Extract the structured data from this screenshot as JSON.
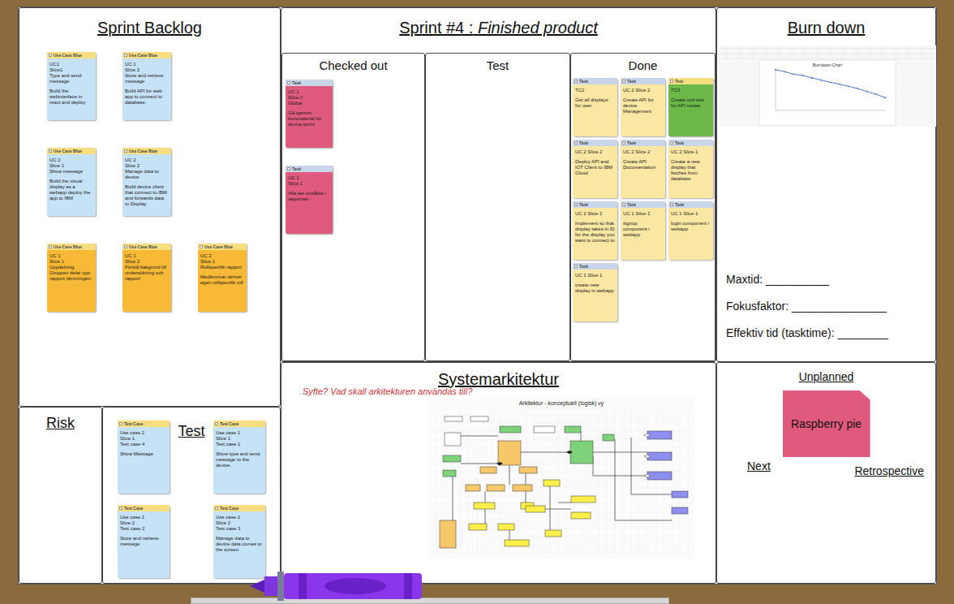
{
  "backlog": {
    "title": "Sprint Backlog",
    "rows": [
      [
        {
          "header": "Use Case Blue",
          "title": [
            "UC1",
            "Slice1",
            "Type and send message"
          ],
          "body": "Build the webinterface in react and deploy",
          "color": "#c5e2f6",
          "header_color": "#f6de80"
        },
        {
          "header": "Use Case Blue",
          "title": [
            "UC 1",
            "Slice 2",
            "Store and retrieve message"
          ],
          "body": "Build API for web app to connect to database.",
          "color": "#c5e2f6",
          "header_color": "#f6de80"
        }
      ],
      [
        {
          "header": "Use Case Blue",
          "title": [
            "UC 2",
            "Slice 1",
            "Show message"
          ],
          "body": "Build the visual display as a webapp deploy the app to IBM",
          "color": "#c5e2f6",
          "header_color": "#f6de80"
        },
        {
          "header": "Use Case Blue",
          "title": [
            "UC 2",
            "Slice 2",
            "Manage data to device"
          ],
          "body": "Build device client that connect to IBM and forwards data to Display",
          "color": "#c5e2f6",
          "header_color": "#f6de80"
        }
      ],
      [
        {
          "header": "Use Case Blue",
          "title": [
            "UC 1",
            "Slice 1",
            "Uppdelning Gruppen delar upp rapport skrivningen"
          ],
          "body": "",
          "color": "#f8b936",
          "header_color": "#f6de80"
        },
        {
          "header": "Use Case Blue",
          "title": [
            "UC 1",
            "Slice 2",
            "Förstå bakgrund till undersökning och rapport"
          ],
          "body": "",
          "color": "#f8b936",
          "header_color": "#f6de80"
        },
        {
          "header": "Use Case Blue",
          "title": [
            "UC 2",
            "Slice 1",
            "Rollspecifik rapport"
          ],
          "body": "Medlemmar skriver egen rollspecifik roll",
          "color": "#f8b936",
          "header_color": "#f6de80"
        }
      ]
    ]
  },
  "sprint": {
    "label": "Sprint #4 :",
    "name": "Finished product",
    "columns": [
      {
        "title": "Checked out",
        "cards": [
          {
            "header": "Task",
            "title": [
              "UC 1",
              "Slice 2",
              "Global"
            ],
            "body": "Gå igenom kursmaterial för denna sprint",
            "color": "#e05a7d",
            "header_color": "#c9d6ea"
          },
          {
            "header": "Task",
            "title": [
              "UC 1",
              "Slice 1"
            ],
            "body": "Alla ser området i rapporten",
            "color": "#e05a7d",
            "header_color": "#c9d6ea"
          }
        ]
      },
      {
        "title": "Test",
        "cards": []
      },
      {
        "title": "Done",
        "cards": [
          {
            "header": "Task",
            "title": [
              "TC2"
            ],
            "body": "Get all displays for user",
            "color": "#fbe7a4",
            "header_color": "#c9d6ea"
          },
          {
            "header": "Task",
            "title": [
              "UC 2 Slice 2"
            ],
            "body": "Create API for device Management",
            "color": "#fbe7a4",
            "header_color": "#c9d6ea"
          },
          {
            "header": "Test",
            "title": [
              "TC3"
            ],
            "body": "Create unit test for API routes",
            "color": "#6cb84a",
            "header_color": "#f6de80"
          },
          {
            "header": "Task",
            "title": [
              "UC 2 Slice 2"
            ],
            "body": "Deploy API and IOT Client to IBM Cloud",
            "color": "#fbe7a4",
            "header_color": "#c9d6ea"
          },
          {
            "header": "Task",
            "title": [
              "UC 2 Slice 2"
            ],
            "body": "Create API Documentation",
            "color": "#fbe7a4",
            "header_color": "#c9d6ea"
          },
          {
            "header": "Task",
            "title": [
              "UC 2 Slice 1"
            ],
            "body": "Create a new display that fetches from database",
            "color": "#fbe7a4",
            "header_color": "#c9d6ea"
          },
          {
            "header": "Task",
            "title": [
              "UC 2 Slice 1"
            ],
            "body": "Implement so that display takes in ID for the display you want to connect to",
            "color": "#fbe7a4",
            "header_color": "#c9d6ea"
          },
          {
            "header": "Task",
            "title": [
              "UC 1 Slice 1"
            ],
            "body": "signup component i webapp",
            "color": "#fbe7a4",
            "header_color": "#c9d6ea"
          },
          {
            "header": "Task",
            "title": [
              "UC 1 Slice 1"
            ],
            "body": "login component i webapp",
            "color": "#fbe7a4",
            "header_color": "#c9d6ea"
          },
          {
            "header": "Task",
            "title": [
              "UC 1 Slice 1"
            ],
            "body": "create new display in webapp",
            "color": "#fbe7a4",
            "header_color": "#c9d6ea"
          }
        ]
      }
    ]
  },
  "burndown": {
    "title": "Burn down",
    "chart": {
      "title": "Burndown Chart",
      "values": [
        130,
        124,
        116,
        112,
        104,
        97,
        90,
        84,
        77,
        70,
        61,
        52,
        41
      ]
    },
    "fields": [
      "Maxtid: __________",
      "Fokusfaktor: _______________",
      "Effektiv tid (tasktime): ________"
    ]
  },
  "risk": {
    "title": "Risk"
  },
  "tests": {
    "title": "Test",
    "cards": [
      {
        "header": "Test Case",
        "title": [
          "Use case 2",
          "Slice 1",
          "Test case 4"
        ],
        "body": "Show Message",
        "color": "#c5e2f6",
        "header_color": "#f6de80"
      },
      {
        "header": "Test Case",
        "title": [
          "Use case 1",
          "Slice 1",
          "Test case 1"
        ],
        "body": "Show type and send message to the device,",
        "color": "#c5e2f6",
        "header_color": "#f6de80"
      },
      {
        "header": "Test Case",
        "title": [
          "Use case 1",
          "Slice 2",
          "Test case 2"
        ],
        "body": "Store and retrieve message",
        "color": "#c5e2f6",
        "header_color": "#f6de80"
      },
      {
        "header": "Test Case",
        "title": [
          "Use case 2",
          "Slice 2",
          "Test case 3"
        ],
        "body": "Manage data to device data comes to the screen",
        "color": "#c5e2f6",
        "header_color": "#f6de80"
      }
    ]
  },
  "architecture": {
    "title": "Systemarkitektur",
    "purpose": "Syfte? Vad skall arkitekturen användas till?",
    "diagram_title": "Arkitektur - konceptuell (logisk) vy"
  },
  "unplanned": {
    "title": "Unplanned",
    "cards": [
      {
        "text": "Raspberry pie",
        "color": "#e05a7d"
      }
    ]
  },
  "next": {
    "title": "Next"
  },
  "retrospective": {
    "title": "Retrospective"
  }
}
